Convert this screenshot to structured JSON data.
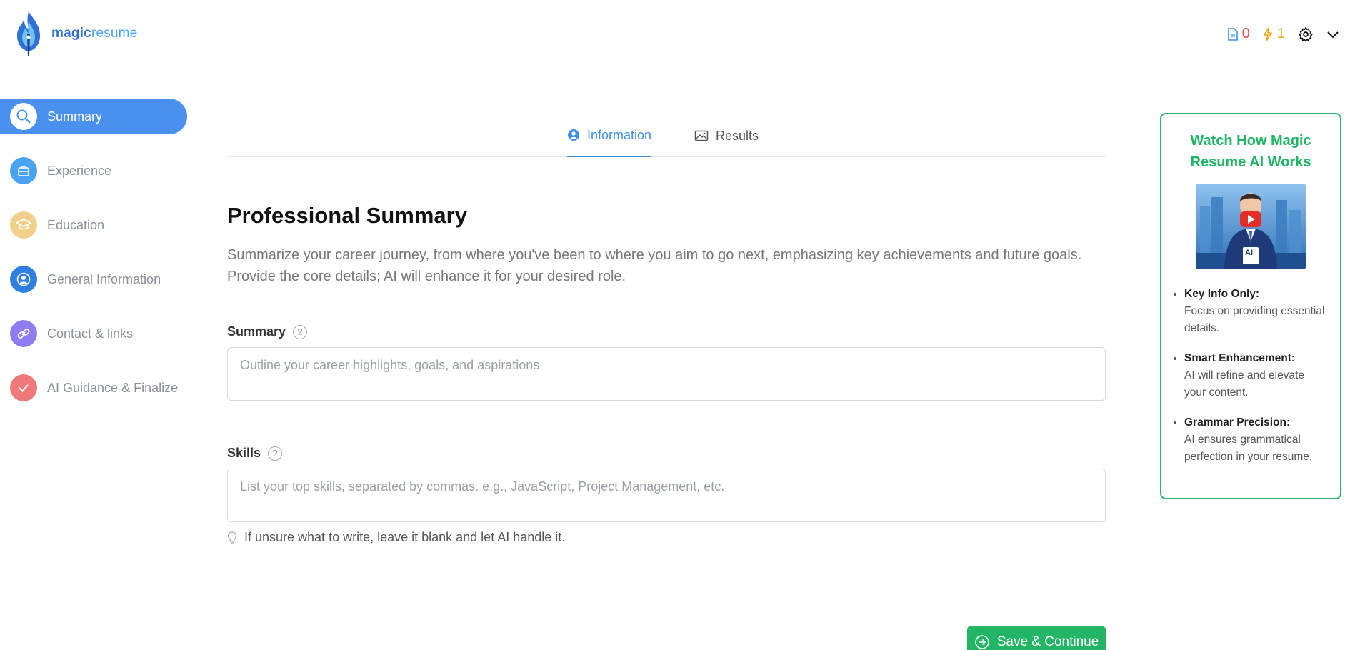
{
  "brand": {
    "part1": "magic",
    "part2": "resume"
  },
  "header": {
    "docs_count": "0",
    "credits_count": "1",
    "colors": {
      "docs": "#e2453c",
      "credits": "#e7a719"
    }
  },
  "sidebar": {
    "items": [
      {
        "label": "Summary",
        "icon": "search-icon",
        "color": "#4a90ee",
        "active": true
      },
      {
        "label": "Experience",
        "icon": "briefcase-icon",
        "color": "#4aa3f0",
        "active": false
      },
      {
        "label": "Education",
        "icon": "graduation-cap-icon",
        "color": "#f0d08a",
        "active": false
      },
      {
        "label": "General Information",
        "icon": "user-circle-icon",
        "color": "#2f7fe0",
        "active": false
      },
      {
        "label": "Contact & links",
        "icon": "link-icon",
        "color": "#8f7cf0",
        "active": false
      },
      {
        "label": "AI Guidance & Finalize",
        "icon": "check-icon",
        "color": "#f07a7a",
        "active": false
      }
    ]
  },
  "tabs": [
    {
      "label": "Information",
      "icon": "user-circle-icon",
      "active": true
    },
    {
      "label": "Results",
      "icon": "image-icon",
      "active": false
    }
  ],
  "main": {
    "title": "Professional Summary",
    "description": "Summarize your career journey, from where you've been to where you aim to go next, emphasizing key achievements and future goals. Provide the core details; AI will enhance it for your desired role.",
    "summary_label": "Summary",
    "summary_placeholder": "Outline your career highlights, goals, and aspirations",
    "summary_value": "",
    "skills_label": "Skills",
    "skills_placeholder": "List your top skills, separated by commas. e.g., JavaScript, Project Management, etc.",
    "skills_value": "",
    "hint": "If unsure what to write, leave it blank and let AI handle it.",
    "save_label": "Save & Continue"
  },
  "panel": {
    "title": "Watch How Magic Resume AI Works",
    "badge": "AI",
    "tips": [
      {
        "key": "Key Info Only:",
        "text": "Focus on providing essential details."
      },
      {
        "key": "Smart Enhancement:",
        "text": "AI will refine and elevate your content."
      },
      {
        "key": "Grammar Precision:",
        "text": "AI ensures grammatical perfection in your resume."
      }
    ]
  }
}
